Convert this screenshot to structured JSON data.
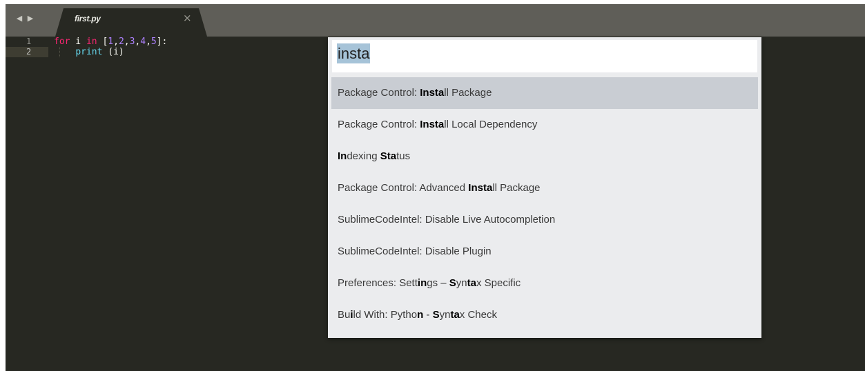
{
  "tabs": [
    {
      "title": "first.py",
      "close_glyph": "×"
    }
  ],
  "nav": {
    "back_icon": "◀",
    "forward_icon": "▶"
  },
  "editor": {
    "line_numbers": [
      "1",
      "2"
    ],
    "lines": [
      {
        "tokens": [
          {
            "text": "for",
            "cls": "kw"
          },
          {
            "text": " i ",
            "cls": ""
          },
          {
            "text": "in",
            "cls": "kw"
          },
          {
            "text": " [",
            "cls": ""
          },
          {
            "text": "1",
            "cls": "num"
          },
          {
            "text": ",",
            "cls": ""
          },
          {
            "text": "2",
            "cls": "num"
          },
          {
            "text": ",",
            "cls": ""
          },
          {
            "text": "3",
            "cls": "num"
          },
          {
            "text": ",",
            "cls": ""
          },
          {
            "text": "4",
            "cls": "num"
          },
          {
            "text": ",",
            "cls": ""
          },
          {
            "text": "5",
            "cls": "num"
          },
          {
            "text": "]:",
            "cls": ""
          }
        ]
      },
      {
        "tokens": [
          {
            "text": "    ",
            "cls": ""
          },
          {
            "text": "print",
            "cls": "fn"
          },
          {
            "text": " (i)",
            "cls": ""
          }
        ]
      }
    ]
  },
  "command_palette": {
    "query": "insta",
    "items": [
      {
        "label": "Package Control: Install Package",
        "segments": [
          [
            "Package Control: ",
            false
          ],
          [
            "Insta",
            true
          ],
          [
            "ll Package",
            false
          ]
        ],
        "selected": true
      },
      {
        "label": "Package Control: Install Local Dependency",
        "segments": [
          [
            "Package Control: ",
            false
          ],
          [
            "Insta",
            true
          ],
          [
            "ll Local Dependency",
            false
          ]
        ],
        "selected": false
      },
      {
        "label": "Indexing Status",
        "segments": [
          [
            "In",
            true
          ],
          [
            "dexing ",
            false
          ],
          [
            "Sta",
            true
          ],
          [
            "tus",
            false
          ]
        ],
        "selected": false
      },
      {
        "label": "Package Control: Advanced Install Package",
        "segments": [
          [
            "Package Control: Advanced ",
            false
          ],
          [
            "Insta",
            true
          ],
          [
            "ll Package",
            false
          ]
        ],
        "selected": false
      },
      {
        "label": "SublimeCodeIntel: Disable Live Autocompletion",
        "segments": [
          [
            "SublimeCodeIntel: Disable Live Autocompletion",
            false
          ]
        ],
        "selected": false
      },
      {
        "label": "SublimeCodeIntel: Disable Plugin",
        "segments": [
          [
            "SublimeCodeIntel: Disable Plugin",
            false
          ]
        ],
        "selected": false
      },
      {
        "label": "Preferences: Settings – Syntax Specific",
        "segments": [
          [
            "Preferences: Sett",
            false
          ],
          [
            "in",
            true
          ],
          [
            "gs – ",
            false
          ],
          [
            "S",
            true
          ],
          [
            "yn",
            false
          ],
          [
            "ta",
            true
          ],
          [
            "x Specific",
            false
          ]
        ],
        "selected": false
      },
      {
        "label": "Build With: Python - Syntax Check",
        "segments": [
          [
            "Bu",
            false
          ],
          [
            "i",
            true
          ],
          [
            "ld With: Pytho",
            false
          ],
          [
            "n",
            true
          ],
          [
            " - ",
            false
          ],
          [
            "S",
            true
          ],
          [
            "yn",
            false
          ],
          [
            "ta",
            true
          ],
          [
            "x Check",
            false
          ]
        ],
        "selected": false
      }
    ]
  },
  "colors": {
    "editor_bg": "#272822",
    "tabbar_bg": "#5f5e58",
    "keyword": "#f92672",
    "number": "#ae81ff",
    "function": "#66d9ef",
    "palette_bg": "#ebecee",
    "palette_selected": "#c9cdd3",
    "query_highlight": "#a6c3d8"
  }
}
